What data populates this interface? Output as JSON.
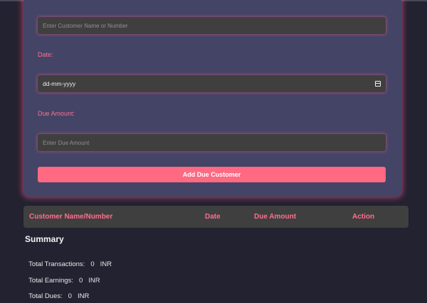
{
  "form": {
    "customer_placeholder": "Enter Customer Name or Number",
    "date_label": "Date:",
    "date_value": "dd-mm-yyyy",
    "due_label": "Due Amount:",
    "due_placeholder": "Enter Due Amount",
    "add_button": "Add Due Customer"
  },
  "table": {
    "headers": [
      "Customer Name/Number",
      "Date",
      "Due Amount",
      "Action"
    ]
  },
  "summary": {
    "title": "Summary",
    "transactions_label": "Total Transactions:",
    "transactions_value": "0",
    "earnings_label": "Total Earnings:",
    "earnings_value": "0",
    "dues_label": "Total Dues:",
    "dues_value": "0",
    "currency": "INR"
  },
  "colors": {
    "accent": "#ff6982",
    "label": "#ff6f8c",
    "card": "#434466",
    "background": "#232231"
  },
  "icons": {
    "date_picker": "calendar-icon"
  }
}
